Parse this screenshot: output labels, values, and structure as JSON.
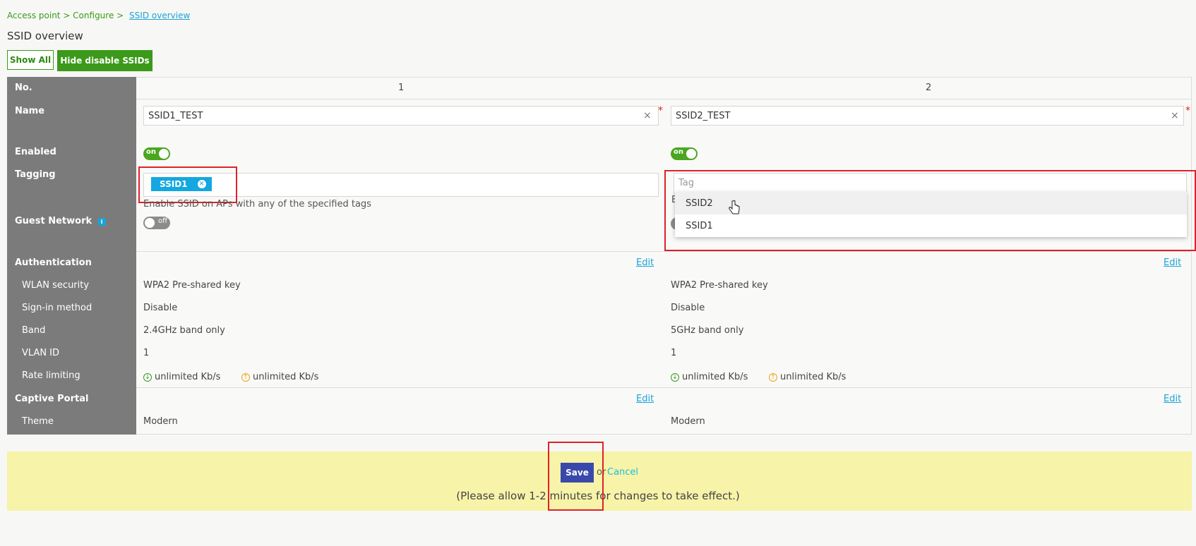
{
  "breadcrumb": {
    "part1": "Access point > Configure >",
    "current": "SSID overview"
  },
  "page_title": "SSID overview",
  "filters": {
    "show_all": "Show All",
    "hide_disabled": "Hide disable SSIDs"
  },
  "rows": {
    "no": "No.",
    "name": "Name",
    "enabled": "Enabled",
    "tagging": "Tagging",
    "guest": "Guest Network",
    "authentication": "Authentication",
    "wlan_security": "WLAN security",
    "sign_in": "Sign-in method",
    "band": "Band",
    "vlan": "VLAN ID",
    "rate": "Rate limiting",
    "captive": "Captive Portal",
    "theme": "Theme"
  },
  "required_mark": "*",
  "clear_glyph": "×",
  "ssid1": {
    "number": "1",
    "name": "SSID1_TEST",
    "enabled": "on",
    "tag": "SSID1",
    "tag_hint": "Enable SSID on APs with any of the specified tags",
    "guest": "off",
    "edit": "Edit",
    "wlan_security": "WPA2 Pre-shared key",
    "sign_in": "Disable",
    "band": "2.4GHz band only",
    "vlan": "1",
    "rate_down": "unlimited Kb/s",
    "rate_up": "unlimited Kb/s",
    "captive_edit": "Edit",
    "theme": "Modern"
  },
  "ssid2": {
    "number": "2",
    "name": "SSID2_TEST",
    "enabled": "on",
    "tag_placeholder": "Tag",
    "hint_fragment": "E",
    "dropdown": [
      "SSID2",
      "SSID1"
    ],
    "edit": "Edit",
    "wlan_security": "WPA2 Pre-shared key",
    "sign_in": "Disable",
    "band": "5GHz band only",
    "vlan": "1",
    "rate_down": "unlimited Kb/s",
    "rate_up": "unlimited Kb/s",
    "captive_edit": "Edit",
    "theme": "Modern"
  },
  "footer": {
    "save": "Save",
    "or": "or",
    "cancel": "Cancel",
    "note": "(Please allow 1-2 minutes for changes to take effect.)"
  },
  "icons": {
    "rate_down": "download-arrow-icon",
    "rate_up": "upload-arrow-icon",
    "info": "info-icon",
    "cursor": "hand-pointer-icon"
  },
  "colors": {
    "accent_green": "#3c9a1a",
    "sidebar_gray": "#7b7b7b",
    "link_blue": "#19a3d8",
    "save_blue": "#3949ab",
    "highlight_red": "#e0202a",
    "save_bar": "#f7f3a8"
  }
}
